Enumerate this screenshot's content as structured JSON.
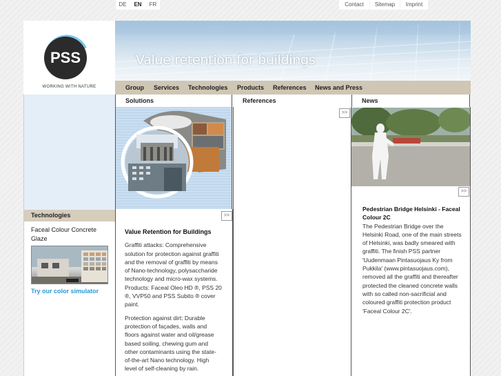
{
  "languages": [
    "DE",
    "EN",
    "FR"
  ],
  "active_language": "EN",
  "top_links": [
    "Contact",
    "Sitemap",
    "Imprint"
  ],
  "logo": {
    "text": "PSS",
    "tagline": "WORKING WITH NATURE"
  },
  "banner": {
    "title": "Value retention for buildings"
  },
  "nav": [
    "Group",
    "Services",
    "Technologies",
    "Products",
    "References",
    "News and Press"
  ],
  "sidebar": {
    "tech_heading": "Technologies",
    "tech_item": "Faceal Colour Concrete Glaze",
    "simulator_link": "Try our color simulator"
  },
  "columns": {
    "solutions": "Solutions",
    "references": "References",
    "news": "News"
  },
  "more_label": ">>",
  "solutions_text": {
    "title": "Value Retention for Buildings",
    "para1": "Graffiti attacks: Comprehensive solution for protection against graffiti and the removal of graffiti by means of Nano-technology, polysaccharide technology and micro-wax systems. Products: Faceal Oleo HD ®, PSS 20 ®, VVP50 and PSS Subito ® cover paint.",
    "para2": "Protection against dirt: Durable protection of façades, walls and floors against water and oil/grease based soiling, chewing gum and other contaminants using the state-of-the-art Nano technology. High level of self-cleaning by rain."
  },
  "news_text": {
    "title": "Pedestrian Bridge Helsinki - Faceal Colour 2C",
    "body": "The Pedestrian Bridge over the Helsinki Road, one of the main streets of Helsinki, was badly smeared with graffiti. The finish PSS partner 'Uudenmaan Pintasuojaus Ky from Pukkila' (www.pintasuojaus.com), removed all the graffiti and thereafter protected the cleaned concrete walls with so called non-sacrificial and coloured graffiti protection product 'Faceal Colour 2C'."
  },
  "colors": {
    "accent_link": "#2a9ad3",
    "nav_bar": "#cfc6b4",
    "sidebar_bg": "#e4eef8"
  }
}
